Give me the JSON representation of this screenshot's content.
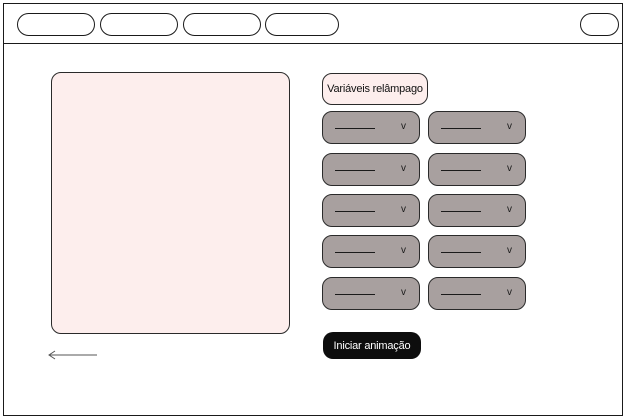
{
  "nav": {
    "tabs": [
      "",
      "",
      "",
      ""
    ],
    "account_button": ""
  },
  "controls": {
    "flash_variables_label": "Variáveis relâmpago",
    "dropdowns": [
      {
        "value": "",
        "chevron": "v"
      },
      {
        "value": "",
        "chevron": "v"
      },
      {
        "value": "",
        "chevron": "v"
      },
      {
        "value": "",
        "chevron": "v"
      },
      {
        "value": "",
        "chevron": "v"
      },
      {
        "value": "",
        "chevron": "v"
      },
      {
        "value": "",
        "chevron": "v"
      },
      {
        "value": "",
        "chevron": "v"
      },
      {
        "value": "",
        "chevron": "v"
      },
      {
        "value": "",
        "chevron": "v"
      }
    ],
    "start_animation_label": "Iniciar animação"
  },
  "colors": {
    "preview_background": "#fdeeed",
    "dropdown_background": "#a8a09f",
    "primary_button": "#0d0d0d"
  },
  "icons": {
    "back": "arrow-left-icon",
    "chevron": "chevron-down-icon"
  }
}
